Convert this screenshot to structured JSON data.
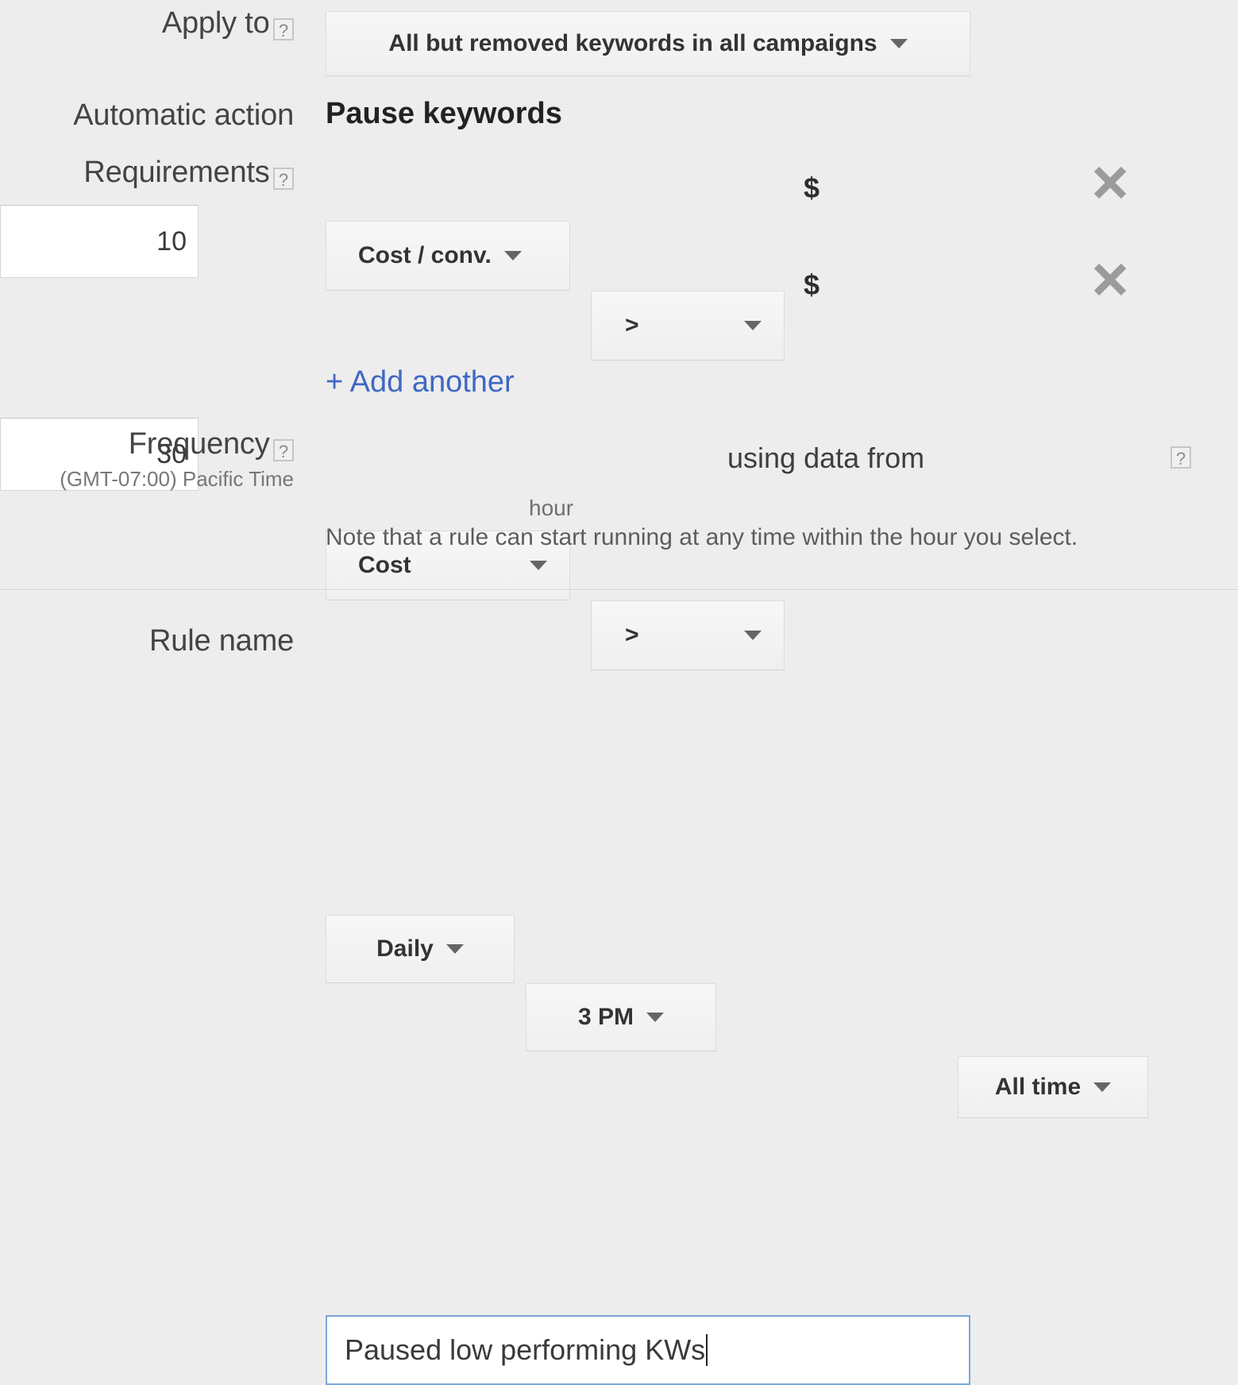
{
  "apply_to": {
    "label": "Apply to",
    "help_icon": "help-question-icon",
    "dropdown_value": "All but removed keywords in all campaigns"
  },
  "automatic_action": {
    "label": "Automatic action",
    "value": "Pause keywords"
  },
  "requirements": {
    "label": "Requirements",
    "help_icon": "help-question-icon",
    "currency_symbol": "$",
    "remove_icon": "close-x-icon",
    "rows": [
      {
        "metric": "Cost / conv.",
        "operator": ">",
        "currency": "$",
        "value": "10"
      },
      {
        "metric": "Cost",
        "operator": ">",
        "currency": "$",
        "value": "30"
      }
    ],
    "add_another_label": "+ Add another"
  },
  "frequency": {
    "label": "Frequency",
    "help_icon": "help-question-icon",
    "timezone_note": "(GMT-07:00) Pacific Time",
    "interval_value": "Daily",
    "hour_value": "3 PM",
    "hour_sublabel": "hour",
    "using_data_from_label": "using data from",
    "data_range_value": "All time",
    "data_range_help_icon": "help-question-icon",
    "note": "Note that a rule can start running at any time within the hour you select."
  },
  "rule_name": {
    "label": "Rule name",
    "value": "Paused low performing KWs",
    "placeholder": ""
  },
  "colors": {
    "page_background": "#ededed",
    "link_blue": "#3f68c4",
    "focus_border_blue": "#7ba7d7",
    "text_dark": "#3c3c3c",
    "muted_text": "#6f6f6f"
  }
}
